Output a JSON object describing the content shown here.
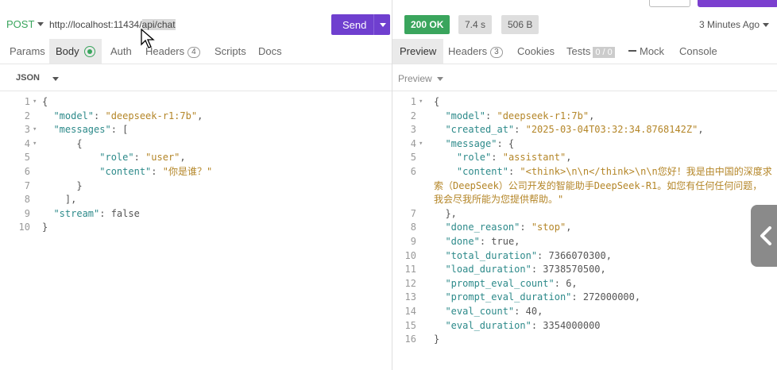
{
  "request": {
    "method": "POST",
    "url_prefix": "http://localhost:11434/",
    "url_selected": "api/chat",
    "send_label": "Send",
    "tabs": [
      {
        "label": "Params"
      },
      {
        "label": "Body"
      },
      {
        "label": "Auth"
      },
      {
        "label": "Headers",
        "count": "4"
      },
      {
        "label": "Scripts"
      },
      {
        "label": "Docs"
      }
    ],
    "body_type": "JSON",
    "lines": [
      [
        [
          "p",
          "{"
        ]
      ],
      [
        [
          "p",
          "  "
        ],
        [
          "k",
          "\"model\""
        ],
        [
          "p",
          ": "
        ],
        [
          "s",
          "\"deepseek-r1:7b\""
        ],
        [
          "p",
          ","
        ]
      ],
      [
        [
          "p",
          "  "
        ],
        [
          "k",
          "\"messages\""
        ],
        [
          "p",
          ": ["
        ]
      ],
      [
        [
          "p",
          "      {"
        ]
      ],
      [
        [
          "p",
          "          "
        ],
        [
          "k",
          "\"role\""
        ],
        [
          "p",
          ": "
        ],
        [
          "s",
          "\"user\""
        ],
        [
          "p",
          ","
        ]
      ],
      [
        [
          "p",
          "          "
        ],
        [
          "k",
          "\"content\""
        ],
        [
          "p",
          ": "
        ],
        [
          "s",
          "\"你是谁？\""
        ]
      ],
      [
        [
          "p",
          "      }"
        ]
      ],
      [
        [
          "p",
          "    ],"
        ]
      ],
      [
        [
          "p",
          "  "
        ],
        [
          "k",
          "\"stream\""
        ],
        [
          "p",
          ": "
        ],
        [
          "b",
          "false"
        ]
      ],
      [
        [
          "p",
          "}"
        ]
      ]
    ]
  },
  "response": {
    "status": "200 OK",
    "time": "7.4 s",
    "size": "506 B",
    "ago": "3 Minutes Ago",
    "tabs": [
      {
        "label": "Preview"
      },
      {
        "label": "Headers",
        "count": "3"
      },
      {
        "label": "Cookies"
      },
      {
        "label": "Tests",
        "badge": "0 / 0"
      },
      {
        "label": "Mock"
      },
      {
        "label": "Console"
      }
    ],
    "preview_label": "Preview",
    "lines": [
      {
        "n": "1",
        "t": [
          [
            "p",
            "{"
          ]
        ]
      },
      {
        "n": "2",
        "t": [
          [
            "p",
            "  "
          ],
          [
            "k",
            "\"model\""
          ],
          [
            "p",
            ": "
          ],
          [
            "s",
            "\"deepseek-r1:7b\""
          ],
          [
            "p",
            ","
          ]
        ]
      },
      {
        "n": "3",
        "t": [
          [
            "p",
            "  "
          ],
          [
            "k",
            "\"created_at\""
          ],
          [
            "p",
            ": "
          ],
          [
            "s",
            "\"2025-03-04T03:32:34.8768142Z\""
          ],
          [
            "p",
            ","
          ]
        ]
      },
      {
        "n": "4",
        "t": [
          [
            "p",
            "  "
          ],
          [
            "k",
            "\"message\""
          ],
          [
            "p",
            ": {"
          ]
        ]
      },
      {
        "n": "5",
        "t": [
          [
            "p",
            "    "
          ],
          [
            "k",
            "\"role\""
          ],
          [
            "p",
            ": "
          ],
          [
            "s",
            "\"assistant\""
          ],
          [
            "p",
            ","
          ]
        ]
      },
      {
        "n": "6",
        "t": [
          [
            "p",
            "    "
          ],
          [
            "k",
            "\"content\""
          ],
          [
            "p",
            ": "
          ],
          [
            "s",
            "\"<think>\\n\\n</think>\\n\\n您好！我是由中国的深度求"
          ]
        ]
      },
      {
        "n": "",
        "t": [
          [
            "s",
            "索（DeepSeek）公司开发的智能助手DeepSeek-R1。如您有任何任何问题，"
          ]
        ]
      },
      {
        "n": "",
        "t": [
          [
            "s",
            "我会尽我所能为您提供帮助。\""
          ]
        ]
      },
      {
        "n": "7",
        "t": [
          [
            "p",
            "  },"
          ]
        ]
      },
      {
        "n": "8",
        "t": [
          [
            "p",
            "  "
          ],
          [
            "k",
            "\"done_reason\""
          ],
          [
            "p",
            ": "
          ],
          [
            "s",
            "\"stop\""
          ],
          [
            "p",
            ","
          ]
        ]
      },
      {
        "n": "9",
        "t": [
          [
            "p",
            "  "
          ],
          [
            "k",
            "\"done\""
          ],
          [
            "p",
            ": "
          ],
          [
            "b",
            "true"
          ],
          [
            "p",
            ","
          ]
        ]
      },
      {
        "n": "10",
        "t": [
          [
            "p",
            "  "
          ],
          [
            "k",
            "\"total_duration\""
          ],
          [
            "p",
            ": "
          ],
          [
            "n",
            "7366070300"
          ],
          [
            "p",
            ","
          ]
        ]
      },
      {
        "n": "11",
        "t": [
          [
            "p",
            "  "
          ],
          [
            "k",
            "\"load_duration\""
          ],
          [
            "p",
            ": "
          ],
          [
            "n",
            "3738570500"
          ],
          [
            "p",
            ","
          ]
        ]
      },
      {
        "n": "12",
        "t": [
          [
            "p",
            "  "
          ],
          [
            "k",
            "\"prompt_eval_count\""
          ],
          [
            "p",
            ": "
          ],
          [
            "n",
            "6"
          ],
          [
            "p",
            ","
          ]
        ]
      },
      {
        "n": "13",
        "t": [
          [
            "p",
            "  "
          ],
          [
            "k",
            "\"prompt_eval_duration\""
          ],
          [
            "p",
            ": "
          ],
          [
            "n",
            "272000000"
          ],
          [
            "p",
            ","
          ]
        ]
      },
      {
        "n": "14",
        "t": [
          [
            "p",
            "  "
          ],
          [
            "k",
            "\"eval_count\""
          ],
          [
            "p",
            ": "
          ],
          [
            "n",
            "40"
          ],
          [
            "p",
            ","
          ]
        ]
      },
      {
        "n": "15",
        "t": [
          [
            "p",
            "  "
          ],
          [
            "k",
            "\"eval_duration\""
          ],
          [
            "p",
            ": "
          ],
          [
            "n",
            "3354000000"
          ]
        ]
      },
      {
        "n": "16",
        "t": [
          [
            "p",
            "}"
          ]
        ]
      }
    ]
  },
  "colors": {
    "accent": "#6f3fcf",
    "success": "#3aa55d",
    "json_key": "#2d8a8a",
    "json_string": "#b48628"
  }
}
